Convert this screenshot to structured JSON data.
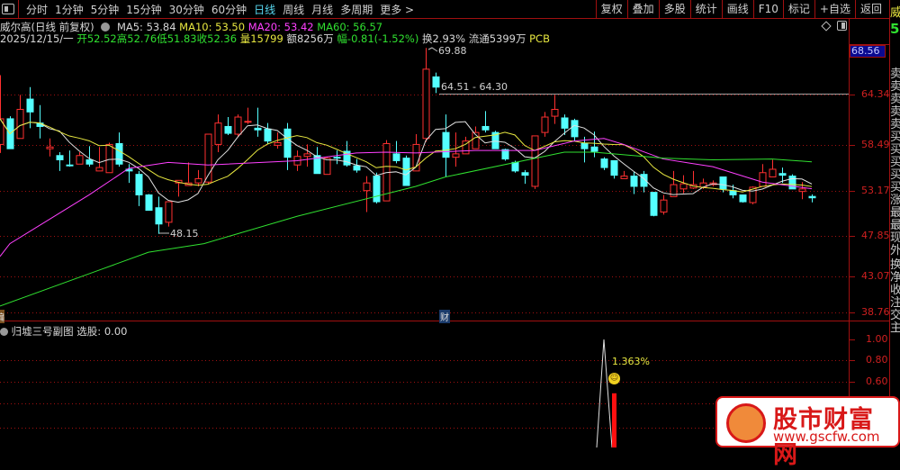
{
  "toolbar": {
    "periods": [
      "分时",
      "1分钟",
      "5分钟",
      "15分钟",
      "30分钟",
      "60分钟",
      "日线",
      "周线",
      "月线",
      "多周期",
      "更多 >"
    ],
    "active_period": "日线",
    "buttons": [
      "复权",
      "叠加",
      "多股",
      "统计",
      "画线",
      "F10",
      "标记",
      "+自选",
      "返回"
    ]
  },
  "info": {
    "title": "威尔高(日线 前复权)",
    "ma5": "MA5: 53.84",
    "ma10": "MA10: 53.50",
    "ma20": "MA20: 53.42",
    "ma60": "MA60: 56.57",
    "date": "2025/12/15/一",
    "open": "开52.52",
    "high": "高52.76",
    "low": "低51.83",
    "close": "收52.36",
    "volume": "量15799",
    "amount": "额8256万",
    "change": "幅-0.81(-1.52%)",
    "turnover": "换2.93% 流通5399万",
    "sector": "PCB"
  },
  "axis": {
    "current": "68.56",
    "ticks": [
      "64.34",
      "58.49",
      "53.17",
      "47.85",
      "43.07",
      "38.76"
    ],
    "sub_ticks": [
      "1.00",
      "0.80",
      "0.60"
    ]
  },
  "annotations": {
    "high": "69.88",
    "low": "48.15",
    "range": "64.51 - 64.30",
    "fin_marker": "财",
    "left_marker": "偏"
  },
  "colors": {
    "up": "#ff3030",
    "down": "#54ffff",
    "ma5": "#e0e0e0",
    "ma10": "#e8e840",
    "ma20": "#ff40ff",
    "ma60": "#30e030",
    "grid": "#a01010"
  },
  "sidebar": {
    "chars": [
      "威",
      "5",
      "卖",
      "卖",
      "卖",
      "卖",
      "卖",
      "买",
      "买",
      "买",
      "买",
      "买",
      "涨",
      "最",
      "最",
      "现",
      "外",
      "换",
      "净",
      "收",
      "注",
      "交",
      "主"
    ]
  },
  "sub_chart": {
    "label": "归墟三号副图 选股: 0.00",
    "signal_index": 61,
    "signal_value": 1.0,
    "bar_index": 62,
    "bar_value": 0.48,
    "annotation": "1.363%"
  },
  "watermark": {
    "name": "股市财富网",
    "url": "www.gscfw.com"
  },
  "chart_data": {
    "type": "candlestick",
    "ylim": [
      38.76,
      69.88
    ],
    "ohlc": [
      [
        58.6,
        66.7,
        57.6,
        61.6
      ],
      [
        61.6,
        61.9,
        58.1,
        58.1
      ],
      [
        59.3,
        64.4,
        59.3,
        62.7
      ],
      [
        63.9,
        65.3,
        60.5,
        62.4
      ],
      [
        61.1,
        63.2,
        59.3,
        60.7
      ],
      [
        58.1,
        59.3,
        57.2,
        58.3
      ],
      [
        57.3,
        57.7,
        55.5,
        56.8
      ],
      [
        56.2,
        57.9,
        56.0,
        56.1
      ],
      [
        56.3,
        57.7,
        56.3,
        57.3
      ],
      [
        56.8,
        58.4,
        56.0,
        56.3
      ],
      [
        55.5,
        58.3,
        55.5,
        55.9
      ],
      [
        55.3,
        58.8,
        55.3,
        58.6
      ],
      [
        58.7,
        60.0,
        56.0,
        56.3
      ],
      [
        55.7,
        56.3,
        54.1,
        55.5
      ],
      [
        55.1,
        55.5,
        51.4,
        52.7
      ],
      [
        52.7,
        52.8,
        50.9,
        50.9
      ],
      [
        51.2,
        52.5,
        48.15,
        49.3
      ],
      [
        49.5,
        51.9,
        49.0,
        51.9
      ],
      [
        54.1,
        54.4,
        52.5,
        54.4
      ],
      [
        53.8,
        56.5,
        53.8,
        54.1
      ],
      [
        54.1,
        55.6,
        53.7,
        54.6
      ],
      [
        54.2,
        59.8,
        54.0,
        59.8
      ],
      [
        58.6,
        62.1,
        57.7,
        61.1
      ],
      [
        60.7,
        61.8,
        59.7,
        59.9
      ],
      [
        59.8,
        62.1,
        59.5,
        61.8
      ],
      [
        61.2,
        62.9,
        61.0,
        61.3
      ],
      [
        60.5,
        62.9,
        59.5,
        60.3
      ],
      [
        60.4,
        61.1,
        58.6,
        59.0
      ],
      [
        58.5,
        60.0,
        58.1,
        58.8
      ],
      [
        60.4,
        61.1,
        55.6,
        57.1
      ],
      [
        56.2,
        57.9,
        55.5,
        57.2
      ],
      [
        57.2,
        58.6,
        56.0,
        57.5
      ],
      [
        57.3,
        58.3,
        55.2,
        55.2
      ],
      [
        55.1,
        57.1,
        55.1,
        57.0
      ],
      [
        57.1,
        57.9,
        56.3,
        57.0
      ],
      [
        57.8,
        59.0,
        56.0,
        56.2
      ],
      [
        56.1,
        56.9,
        55.3,
        55.6
      ],
      [
        53.2,
        54.9,
        50.7,
        54.1
      ],
      [
        54.9,
        55.3,
        51.7,
        51.9
      ],
      [
        52.0,
        59.1,
        52.0,
        58.7
      ],
      [
        57.5,
        59.0,
        56.4,
        56.7
      ],
      [
        57.0,
        57.3,
        53.8,
        53.8
      ],
      [
        55.5,
        59.8,
        55.5,
        58.6
      ],
      [
        59.3,
        69.88,
        58.9,
        67.4
      ],
      [
        66.5,
        67.0,
        64.6,
        65.3
      ],
      [
        60.0,
        62.1,
        54.8,
        57.1
      ],
      [
        57.1,
        60.0,
        56.0,
        57.5
      ],
      [
        57.5,
        59.5,
        57.5,
        59.0
      ],
      [
        58.1,
        60.7,
        58.1,
        60.0
      ],
      [
        60.7,
        62.5,
        60.0,
        60.3
      ],
      [
        60.0,
        60.2,
        58.1,
        58.1
      ],
      [
        58.0,
        58.1,
        56.7,
        56.9
      ],
      [
        56.5,
        56.7,
        55.3,
        55.5
      ],
      [
        55.3,
        55.6,
        54.0,
        55.0
      ],
      [
        53.7,
        59.6,
        53.4,
        59.6
      ],
      [
        60.0,
        62.4,
        59.5,
        61.8
      ],
      [
        61.9,
        64.4,
        61.0,
        62.7
      ],
      [
        61.7,
        62.1,
        59.7,
        60.5
      ],
      [
        61.4,
        61.6,
        59.0,
        59.5
      ],
      [
        58.7,
        59.5,
        56.5,
        58.1
      ],
      [
        58.3,
        60.1,
        57.1,
        57.8
      ],
      [
        56.9,
        57.1,
        55.6,
        55.9
      ],
      [
        56.7,
        56.7,
        54.6,
        55.0
      ],
      [
        54.6,
        55.5,
        54.6,
        54.9
      ],
      [
        54.9,
        55.4,
        52.8,
        53.7
      ],
      [
        55.1,
        55.5,
        53.0,
        53.7
      ],
      [
        53.0,
        53.0,
        50.2,
        50.3
      ],
      [
        50.7,
        52.7,
        50.4,
        52.1
      ],
      [
        52.5,
        55.5,
        52.5,
        53.9
      ],
      [
        53.4,
        55.0,
        52.9,
        54.0
      ],
      [
        53.5,
        55.5,
        53.4,
        53.9
      ],
      [
        53.6,
        54.6,
        53.4,
        54.1
      ],
      [
        53.9,
        54.4,
        53.7,
        54.1
      ],
      [
        54.8,
        54.8,
        53.0,
        53.4
      ],
      [
        53.2,
        53.9,
        52.3,
        52.7
      ],
      [
        52.7,
        52.7,
        51.8,
        51.9
      ],
      [
        51.8,
        53.7,
        51.6,
        53.6
      ],
      [
        53.7,
        56.3,
        53.7,
        55.3
      ],
      [
        54.8,
        56.8,
        54.8,
        55.7
      ],
      [
        55.2,
        55.9,
        54.1,
        55.0
      ],
      [
        54.9,
        55.1,
        53.4,
        53.4
      ],
      [
        53.1,
        54.2,
        52.2,
        53.4
      ],
      [
        52.52,
        52.76,
        51.83,
        52.36
      ]
    ],
    "ma20_points": [
      [
        0,
        45.5
      ],
      [
        1,
        47.0
      ],
      [
        9,
        52.7
      ],
      [
        13,
        55.8
      ],
      [
        17,
        56.5
      ],
      [
        21,
        56.2
      ],
      [
        30,
        56.7
      ],
      [
        36,
        57.6
      ],
      [
        39,
        57.7
      ],
      [
        42,
        57.6
      ],
      [
        48,
        57.9
      ],
      [
        54,
        57.9
      ],
      [
        58,
        59.0
      ],
      [
        61,
        59.3
      ],
      [
        63,
        58.6
      ],
      [
        67,
        56.9
      ],
      [
        72,
        56.0
      ],
      [
        77,
        54.2
      ],
      [
        82,
        53.42
      ]
    ],
    "ma60_points": [
      [
        0,
        39.7
      ],
      [
        10,
        43.9
      ],
      [
        15,
        46.0
      ],
      [
        20.6,
        47.0
      ],
      [
        30,
        50.2
      ],
      [
        42,
        53.7
      ],
      [
        45,
        54.8
      ],
      [
        57,
        57.7
      ],
      [
        60,
        57.7
      ],
      [
        67,
        57.0
      ],
      [
        72,
        56.8
      ],
      [
        78,
        56.9
      ],
      [
        82,
        56.57
      ]
    ]
  }
}
